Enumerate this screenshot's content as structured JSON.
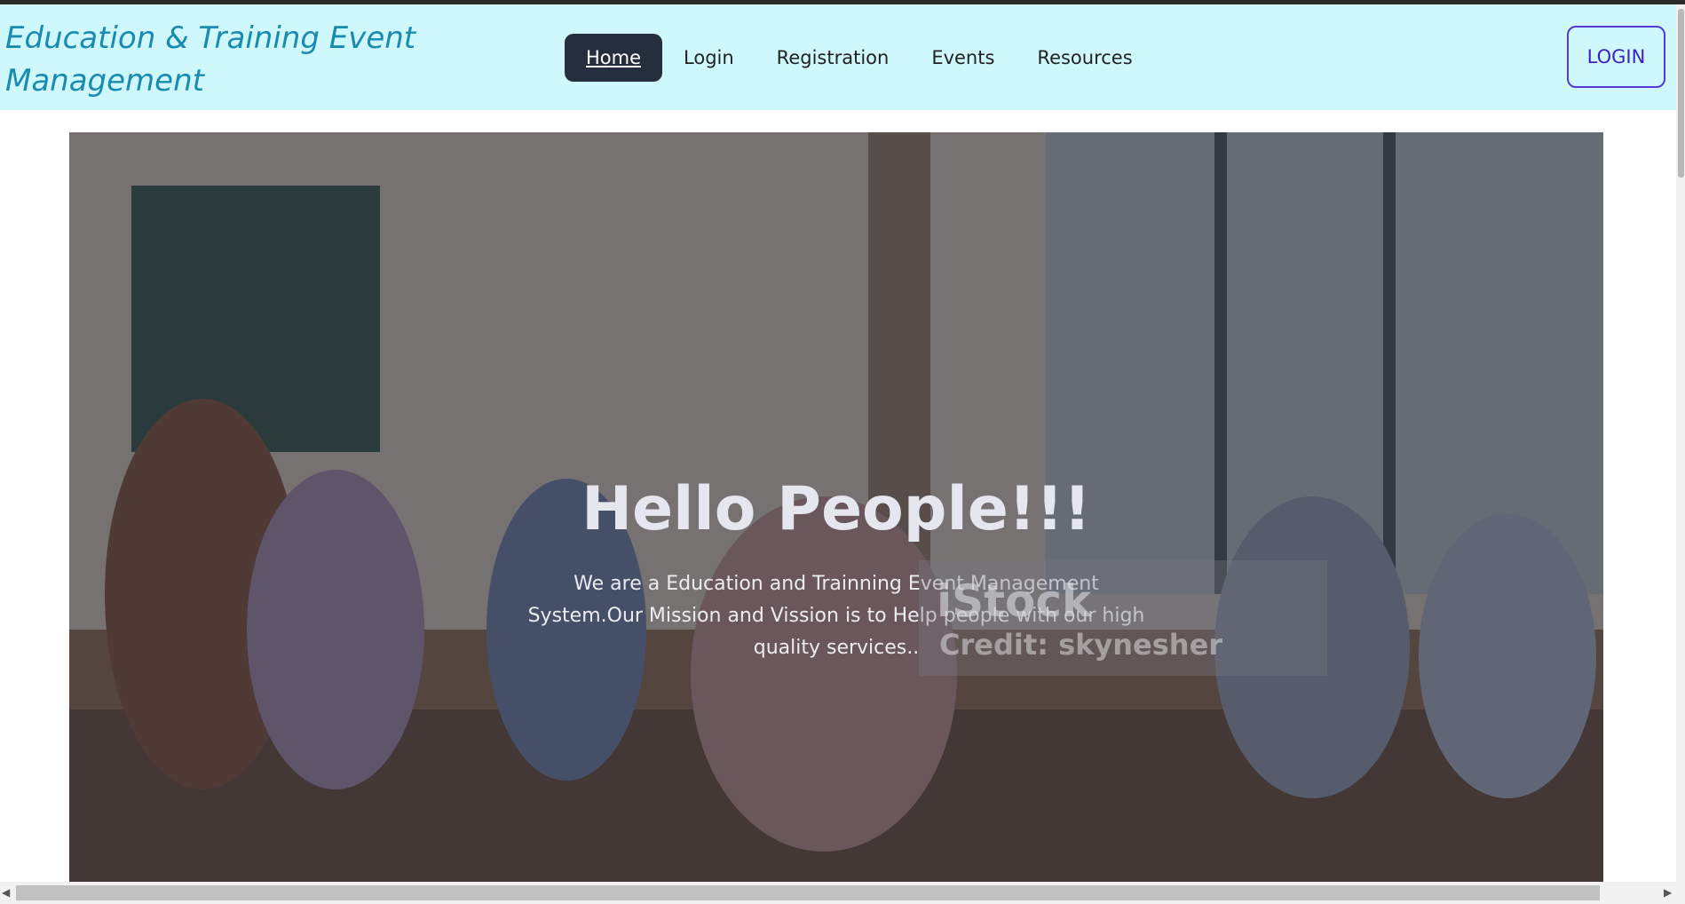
{
  "brand": {
    "title": "Education & Training Event Management"
  },
  "nav": {
    "items": [
      {
        "label": "Home",
        "active": true
      },
      {
        "label": "Login",
        "active": false
      },
      {
        "label": "Registration",
        "active": false
      },
      {
        "label": "Events",
        "active": false
      },
      {
        "label": "Resources",
        "active": false
      }
    ],
    "login_button": "LOGIN"
  },
  "hero": {
    "title": "Hello People!!!",
    "text": "We are a Education and Trainning Event Management System.Our Mission and Vission is to Help people with our high quality services..",
    "watermark_logo": "iStock",
    "watermark_credit": "Credit: skynesher"
  },
  "colors": {
    "navbar_bg": "#cff8fc",
    "brand_text": "#1a8bb0",
    "active_nav_bg": "#252e3c",
    "login_border": "#5538d8"
  },
  "icons": {
    "scroll_left": "triangle-left-icon",
    "scroll_right": "triangle-right-icon"
  }
}
